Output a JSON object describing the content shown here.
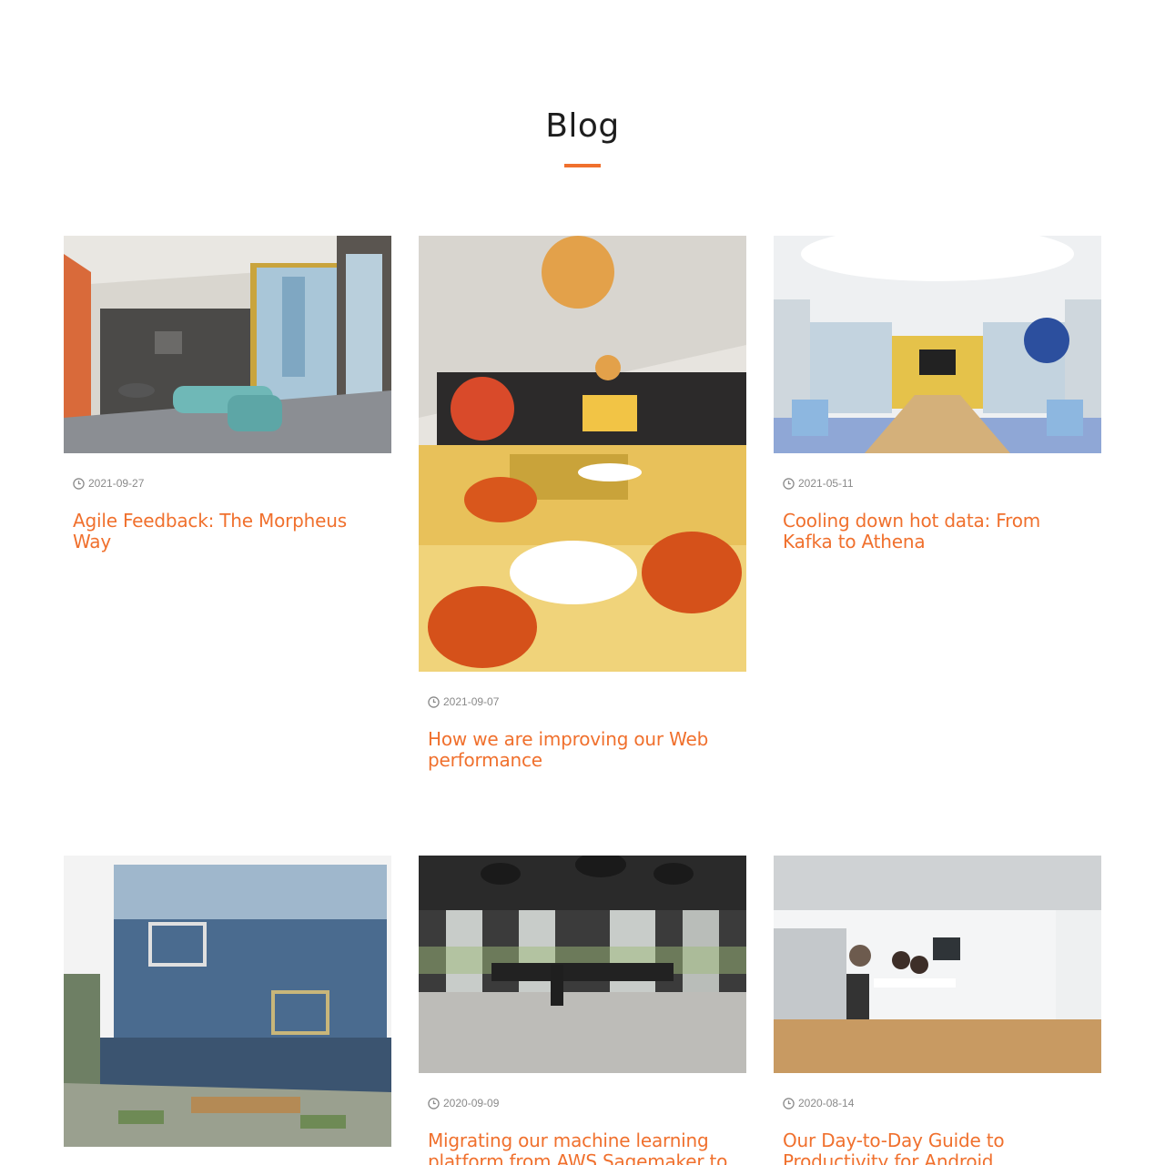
{
  "page": {
    "title": "Blog",
    "accent_color": "#f0702d"
  },
  "posts": [
    {
      "date": "2021-09-27",
      "title": "Agile Feedback: The Morpheus Way",
      "image": "lounge-chalkboard-photo"
    },
    {
      "date": "2021-09-07",
      "title": "How we are improving our Web performance",
      "image": "pop-art-cafe-photo"
    },
    {
      "date": "2021-05-11",
      "title": "Cooling down hot data: From Kafka to Athena",
      "image": "meeting-room-photo"
    },
    {
      "date": "",
      "title": "",
      "image": "glass-building-courtyard-photo"
    },
    {
      "date": "2020-09-09",
      "title": "Migrating our machine learning platform from AWS Sagemaker to",
      "image": "open-office-photo"
    },
    {
      "date": "2020-08-14",
      "title": "Our Day-to-Day Guide to Productivity for Android developers",
      "image": "glass-office-team-photo"
    }
  ]
}
